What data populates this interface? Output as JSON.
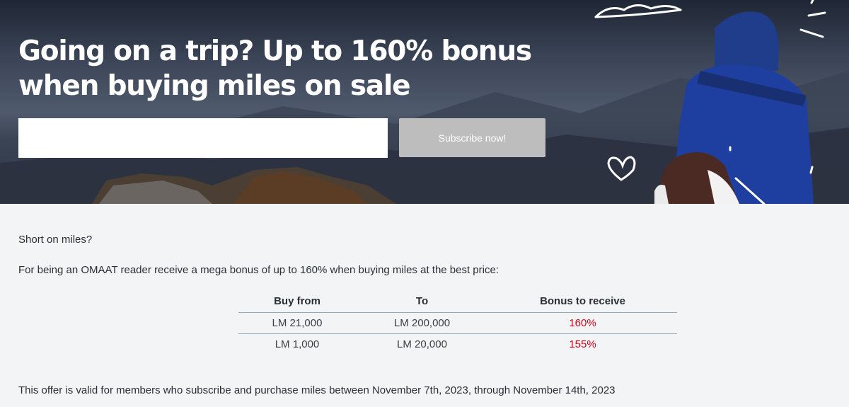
{
  "hero": {
    "title": "Going on a trip? Up to 160% bonus when buying miles on sale",
    "email_value": "",
    "subscribe_label": "Subscribe now!"
  },
  "content": {
    "intro": "Short on miles?",
    "description": "For being an OMAAT reader receive a mega bonus of up to 160% when buying miles at the best price:",
    "table": {
      "headers": [
        "Buy from",
        "To",
        "Bonus to receive"
      ],
      "rows": [
        [
          "LM 21,000",
          "LM 200,000",
          "160%"
        ],
        [
          "LM 1,000",
          "LM 20,000",
          "155%"
        ]
      ]
    },
    "terms": "This offer is valid for members who subscribe and purchase miles between November 7th, 2023, through November 14th, 2023"
  },
  "colors": {
    "bonus_text": "#d0021b",
    "button_bg": "#bdbdbd",
    "page_bg": "#f3f4f6"
  },
  "icons": [
    "heart-doodle-icon",
    "cloud-doodle-icon"
  ]
}
